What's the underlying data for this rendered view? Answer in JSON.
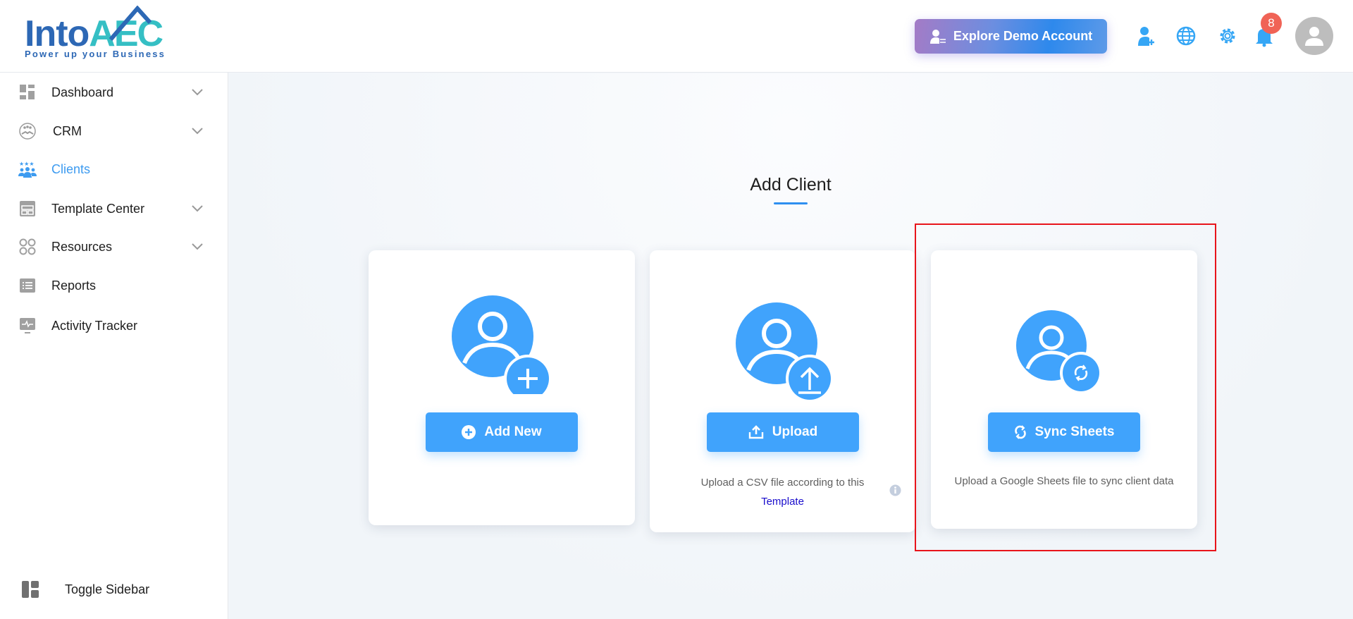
{
  "header": {
    "logo_into": "Into",
    "logo_aec": "AEC",
    "tagline": "Power up your Business",
    "demo_button": "Explore Demo Account",
    "notification_count": "8"
  },
  "sidebar": {
    "items": [
      {
        "label": "Dashboard",
        "icon": "dashboard-icon",
        "expandable": true
      },
      {
        "label": "CRM",
        "icon": "handshake-icon",
        "expandable": true
      },
      {
        "label": "Clients",
        "icon": "clients-icon",
        "expandable": false,
        "active": true
      },
      {
        "label": "Template Center",
        "icon": "template-icon",
        "expandable": true
      },
      {
        "label": "Resources",
        "icon": "resources-icon",
        "expandable": true
      },
      {
        "label": "Reports",
        "icon": "reports-icon",
        "expandable": false
      },
      {
        "label": "Activity Tracker",
        "icon": "activity-icon",
        "expandable": false
      }
    ],
    "toggle_label": "Toggle Sidebar"
  },
  "main": {
    "title": "Add Client",
    "cards": [
      {
        "button": "Add New"
      },
      {
        "button": "Upload",
        "desc": "Upload a CSV file according to this",
        "link": "Template"
      },
      {
        "button": "Sync Sheets",
        "desc": "Upload a Google Sheets file to sync client data"
      }
    ]
  },
  "colors": {
    "accent": "#40a3fc",
    "active": "#3d9bf0",
    "highlight": "#e8141b",
    "badge": "#f06356"
  }
}
